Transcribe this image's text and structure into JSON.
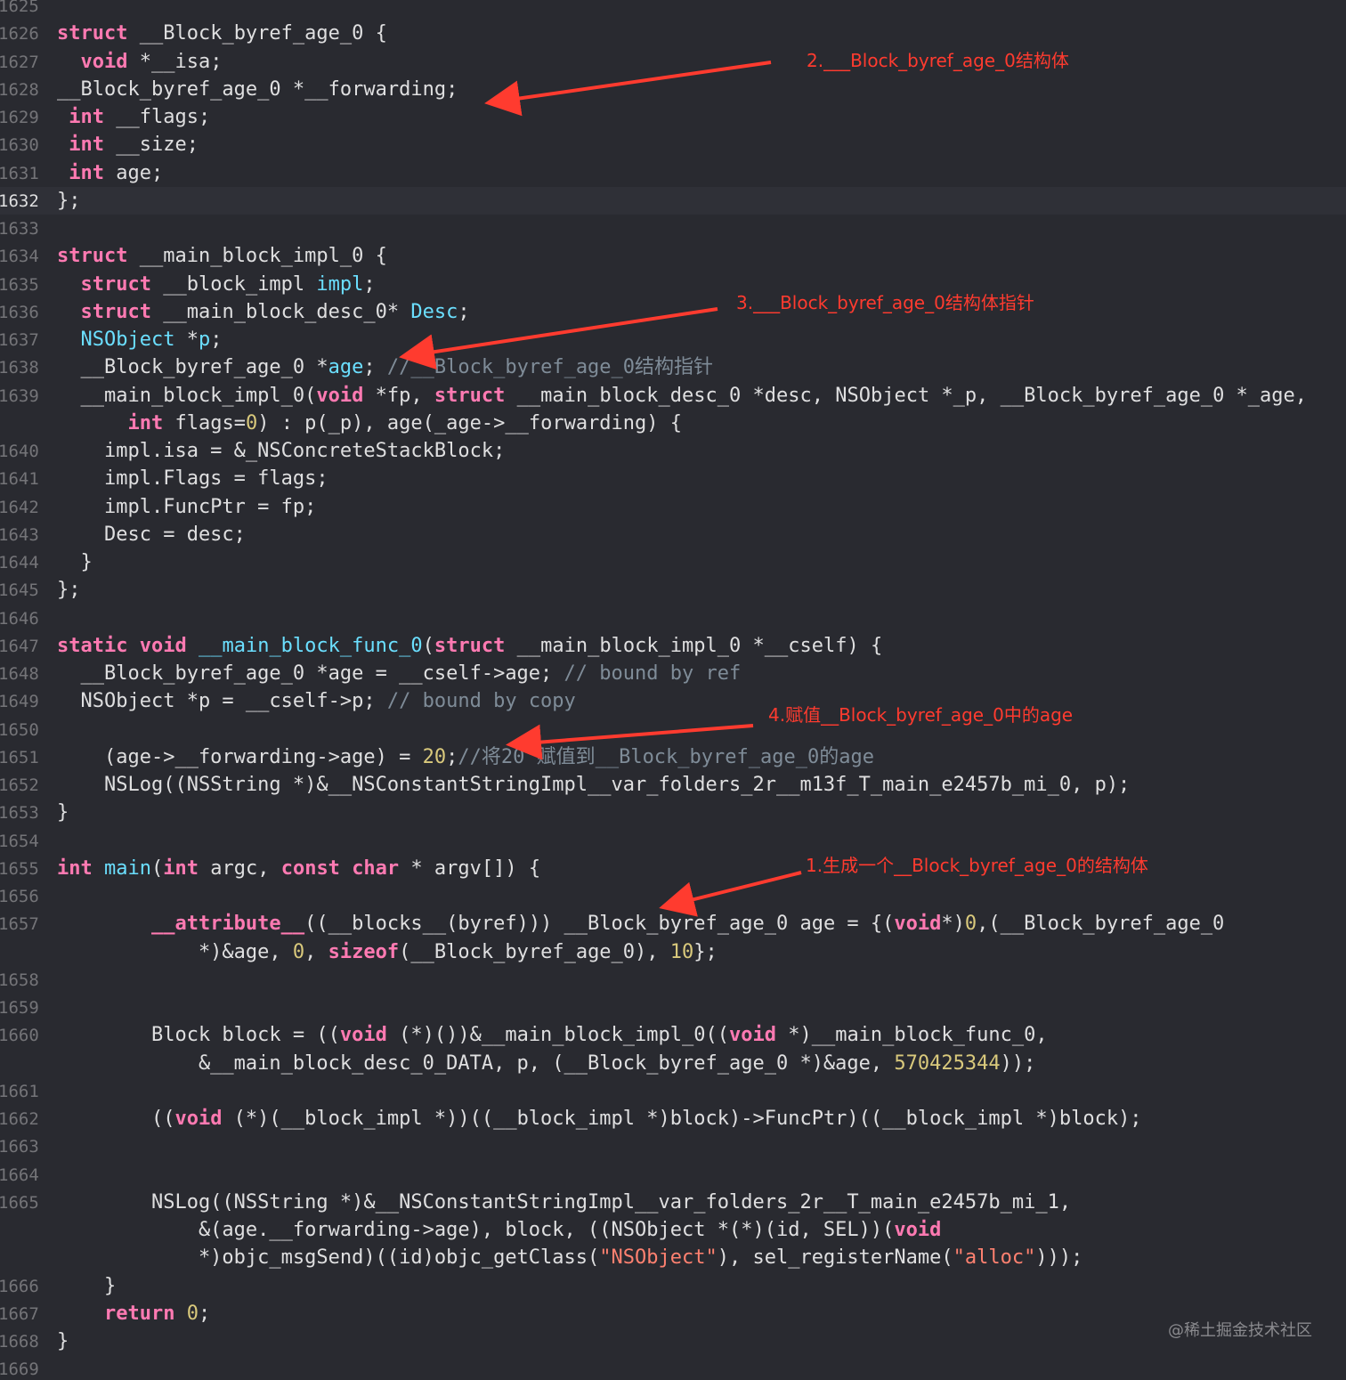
{
  "code_lines": [
    {
      "number": "1625",
      "segments": []
    },
    {
      "number": "1626",
      "segments": [
        [
          "kw",
          "struct"
        ],
        [
          "plain",
          " __Block_byref_age_0 {"
        ]
      ]
    },
    {
      "number": "1627",
      "segments": [
        [
          "plain",
          "  "
        ],
        [
          "kw",
          "void"
        ],
        [
          "plain",
          " *__isa;"
        ]
      ]
    },
    {
      "number": "1628",
      "segments": [
        [
          "plain",
          "__Block_byref_age_0 *__forwarding;"
        ]
      ]
    },
    {
      "number": "1629",
      "segments": [
        [
          "plain",
          " "
        ],
        [
          "kw",
          "int"
        ],
        [
          "plain",
          " __flags;"
        ]
      ]
    },
    {
      "number": "1630",
      "segments": [
        [
          "plain",
          " "
        ],
        [
          "kw",
          "int"
        ],
        [
          "plain",
          " __size;"
        ]
      ]
    },
    {
      "number": "1631",
      "segments": [
        [
          "plain",
          " "
        ],
        [
          "kw",
          "int"
        ],
        [
          "plain",
          " age;"
        ]
      ]
    },
    {
      "number": "1632",
      "segments": [
        [
          "plain",
          "};"
        ]
      ]
    },
    {
      "number": "1633",
      "segments": []
    },
    {
      "number": "1634",
      "segments": [
        [
          "kw",
          "struct"
        ],
        [
          "plain",
          " __main_block_impl_0 {"
        ]
      ]
    },
    {
      "number": "1635",
      "segments": [
        [
          "plain",
          "  "
        ],
        [
          "kw",
          "struct"
        ],
        [
          "plain",
          " __block_impl "
        ],
        [
          "type",
          "impl"
        ],
        [
          "plain",
          ";"
        ]
      ]
    },
    {
      "number": "1636",
      "segments": [
        [
          "plain",
          "  "
        ],
        [
          "kw",
          "struct"
        ],
        [
          "plain",
          " __main_block_desc_0* "
        ],
        [
          "type",
          "Desc"
        ],
        [
          "plain",
          ";"
        ]
      ]
    },
    {
      "number": "1637",
      "segments": [
        [
          "plain",
          "  "
        ],
        [
          "type",
          "NSObject"
        ],
        [
          "plain",
          " *"
        ],
        [
          "type",
          "p"
        ],
        [
          "plain",
          ";"
        ]
      ]
    },
    {
      "number": "1638",
      "segments": [
        [
          "plain",
          "  __Block_byref_age_0 *"
        ],
        [
          "type",
          "age"
        ],
        [
          "plain",
          "; "
        ],
        [
          "cmt",
          "//__Block_byref_age_0结构指针"
        ]
      ]
    },
    {
      "number": "1639",
      "segments": [
        [
          "plain",
          "  __main_block_impl_0("
        ],
        [
          "kw",
          "void"
        ],
        [
          "plain",
          " *fp, "
        ],
        [
          "kw",
          "struct"
        ],
        [
          "plain",
          " __main_block_desc_0 *desc, NSObject *_p, __Block_byref_age_0 *_age,"
        ]
      ]
    },
    {
      "number": "",
      "segments": [
        [
          "plain",
          "      "
        ],
        [
          "kw",
          "int"
        ],
        [
          "plain",
          " flags="
        ],
        [
          "num",
          "0"
        ],
        [
          "plain",
          ") : p(_p), age(_age->__forwarding) {"
        ]
      ]
    },
    {
      "number": "1640",
      "segments": [
        [
          "plain",
          "    impl.isa = &_NSConcreteStackBlock;"
        ]
      ]
    },
    {
      "number": "1641",
      "segments": [
        [
          "plain",
          "    impl.Flags = flags;"
        ]
      ]
    },
    {
      "number": "1642",
      "segments": [
        [
          "plain",
          "    impl.FuncPtr = fp;"
        ]
      ]
    },
    {
      "number": "1643",
      "segments": [
        [
          "plain",
          "    Desc = desc;"
        ]
      ]
    },
    {
      "number": "1644",
      "segments": [
        [
          "plain",
          "  }"
        ]
      ]
    },
    {
      "number": "1645",
      "segments": [
        [
          "plain",
          "};"
        ]
      ]
    },
    {
      "number": "1646",
      "segments": []
    },
    {
      "number": "1647",
      "segments": [
        [
          "kw",
          "static"
        ],
        [
          "plain",
          " "
        ],
        [
          "kw",
          "void"
        ],
        [
          "plain",
          " "
        ],
        [
          "type",
          "__main_block_func_0"
        ],
        [
          "plain",
          "("
        ],
        [
          "kw",
          "struct"
        ],
        [
          "plain",
          " __main_block_impl_0 *__cself) {"
        ]
      ]
    },
    {
      "number": "1648",
      "segments": [
        [
          "plain",
          "  __Block_byref_age_0 *age = __cself->age; "
        ],
        [
          "cmt",
          "// bound by ref"
        ]
      ]
    },
    {
      "number": "1649",
      "segments": [
        [
          "plain",
          "  NSObject *p = __cself->p; "
        ],
        [
          "cmt",
          "// bound by copy"
        ]
      ]
    },
    {
      "number": "1650",
      "segments": []
    },
    {
      "number": "1651",
      "segments": [
        [
          "plain",
          "    (age->__forwarding->age) = "
        ],
        [
          "num",
          "20"
        ],
        [
          "plain",
          ";"
        ],
        [
          "cmt",
          "//将20 赋值到__Block_byref_age_0的age"
        ]
      ]
    },
    {
      "number": "1652",
      "segments": [
        [
          "plain",
          "    NSLog((NSString *)&__NSConstantStringImpl__var_folders_2r__m13f_T_main_e2457b_mi_0, p);"
        ]
      ]
    },
    {
      "number": "1653",
      "segments": [
        [
          "plain",
          "}"
        ]
      ]
    },
    {
      "number": "1654",
      "segments": []
    },
    {
      "number": "1655",
      "segments": [
        [
          "kw",
          "int"
        ],
        [
          "plain",
          " "
        ],
        [
          "type",
          "main"
        ],
        [
          "plain",
          "("
        ],
        [
          "kw",
          "int"
        ],
        [
          "plain",
          " argc, "
        ],
        [
          "kw",
          "const"
        ],
        [
          "plain",
          " "
        ],
        [
          "kw",
          "char"
        ],
        [
          "plain",
          " * argv[]) {"
        ]
      ]
    },
    {
      "number": "1656",
      "segments": []
    },
    {
      "number": "1657",
      "segments": [
        [
          "plain",
          "        "
        ],
        [
          "kw",
          "__attribute__"
        ],
        [
          "plain",
          "((__blocks__(byref))) __Block_byref_age_0 age = {("
        ],
        [
          "kw",
          "void"
        ],
        [
          "plain",
          "*)"
        ],
        [
          "num",
          "0"
        ],
        [
          "plain",
          ",(__Block_byref_age_0"
        ]
      ]
    },
    {
      "number": "",
      "segments": [
        [
          "plain",
          "            *)&age, "
        ],
        [
          "num",
          "0"
        ],
        [
          "plain",
          ", "
        ],
        [
          "kw",
          "sizeof"
        ],
        [
          "plain",
          "(__Block_byref_age_0), "
        ],
        [
          "num",
          "10"
        ],
        [
          "plain",
          "};"
        ]
      ]
    },
    {
      "number": "1658",
      "segments": []
    },
    {
      "number": "1659",
      "segments": []
    },
    {
      "number": "1660",
      "segments": [
        [
          "plain",
          "        Block block = (("
        ],
        [
          "kw",
          "void"
        ],
        [
          "plain",
          " (*)())&__main_block_impl_0(("
        ],
        [
          "kw",
          "void"
        ],
        [
          "plain",
          " *)__main_block_func_0,"
        ]
      ]
    },
    {
      "number": "",
      "segments": [
        [
          "plain",
          "            &__main_block_desc_0_DATA, p, (__Block_byref_age_0 *)&age, "
        ],
        [
          "num",
          "570425344"
        ],
        [
          "plain",
          "));"
        ]
      ]
    },
    {
      "number": "1661",
      "segments": []
    },
    {
      "number": "1662",
      "segments": [
        [
          "plain",
          "        (("
        ],
        [
          "kw",
          "void"
        ],
        [
          "plain",
          " (*)(__block_impl *))((__block_impl *)block)->FuncPtr)((__block_impl *)block);"
        ]
      ]
    },
    {
      "number": "1663",
      "segments": []
    },
    {
      "number": "1664",
      "segments": []
    },
    {
      "number": "1665",
      "segments": [
        [
          "plain",
          "        NSLog((NSString *)&__NSConstantStringImpl__var_folders_2r__T_main_e2457b_mi_1,"
        ]
      ]
    },
    {
      "number": "",
      "segments": [
        [
          "plain",
          "            &(age.__forwarding->age), block, ((NSObject *(*)(id, SEL))("
        ],
        [
          "kw",
          "void"
        ]
      ]
    },
    {
      "number": "",
      "segments": [
        [
          "plain",
          "            *)objc_msgSend)((id)objc_getClass("
        ],
        [
          "str",
          "\"NSObject\""
        ],
        [
          "plain",
          "), sel_registerName("
        ],
        [
          "str",
          "\"alloc\""
        ],
        [
          "plain",
          ")));"
        ]
      ]
    },
    {
      "number": "1666",
      "segments": [
        [
          "plain",
          "    }"
        ]
      ]
    },
    {
      "number": "1667",
      "segments": [
        [
          "plain",
          "    "
        ],
        [
          "kw",
          "return"
        ],
        [
          "plain",
          " "
        ],
        [
          "num",
          "0"
        ],
        [
          "plain",
          ";"
        ]
      ]
    },
    {
      "number": "1668",
      "segments": [
        [
          "plain",
          "}"
        ]
      ]
    },
    {
      "number": "1669",
      "segments": []
    }
  ],
  "current_line": "1632",
  "annotations": {
    "a2": "2.___Block_byref_age_0结构体",
    "a3": "3.___Block_byref_age_0结构体指针",
    "a4": "4.赋值__Block_byref_age_0中的age",
    "a1": "1.生成一个__Block_byref_age_0的结构体"
  },
  "watermark": "@稀土掘金技术社区",
  "colors": {
    "background": "#292a30",
    "keyword": "#ff7ab2",
    "type": "#6bdfff",
    "number": "#d9c97c",
    "string": "#ff8170",
    "comment": "#7f8c98",
    "annotation": "#ff3b2f"
  }
}
